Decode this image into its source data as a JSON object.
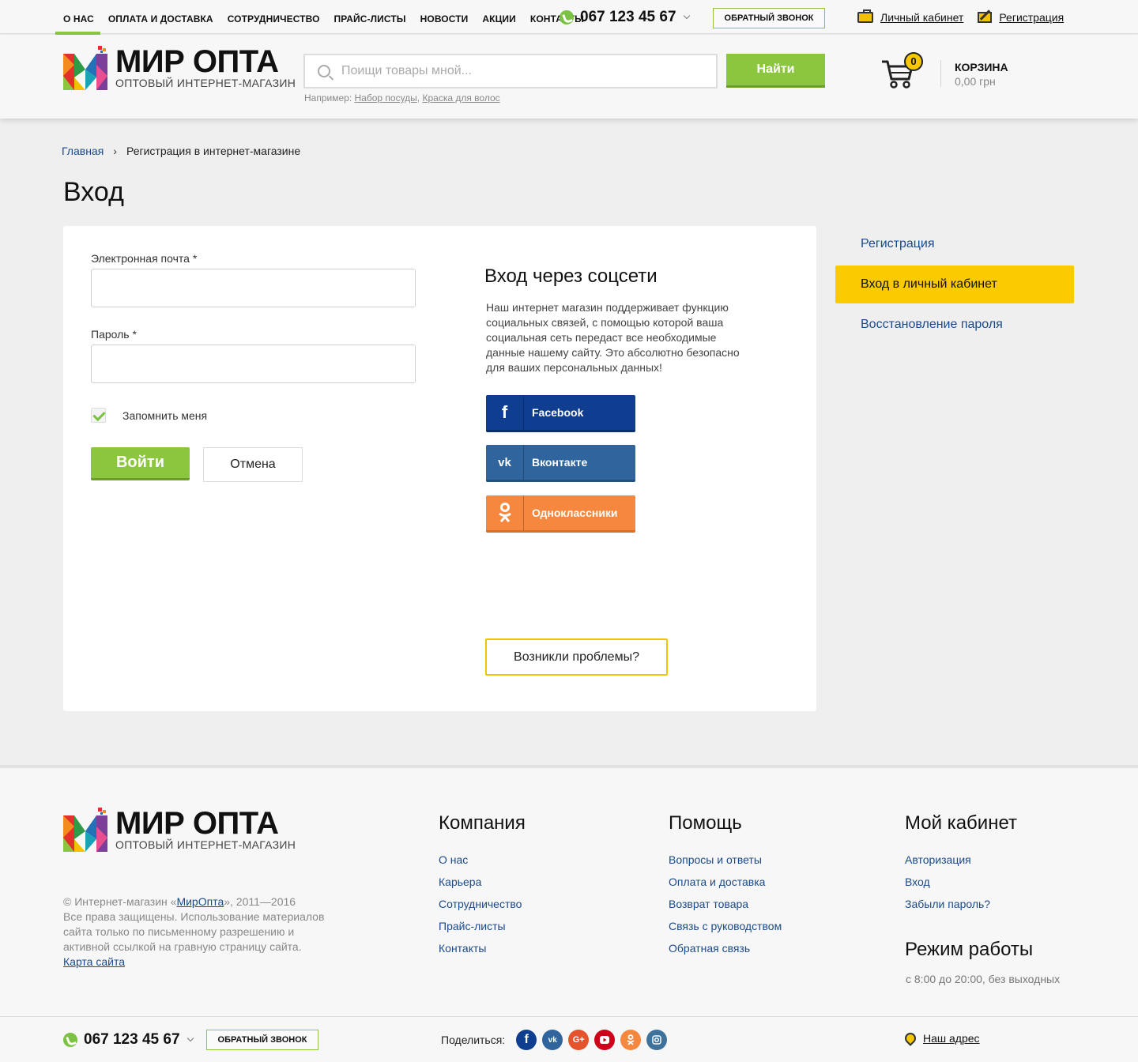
{
  "topnav": {
    "items": [
      "О нас",
      "Оплата и доставка",
      "Сотрудничество",
      "Прайс-листы",
      "Новости",
      "Акции",
      "Контакты"
    ],
    "phone": "067 123 45 67",
    "callback": "Обратный звонок",
    "account_link": "Личный кабинет",
    "register_link": "Регистрация"
  },
  "header": {
    "logo_title": "МИР ОПТА",
    "logo_subtitle": "ОПТОВЫЙ ИНТЕРНЕТ-МАГАЗИН",
    "search_placeholder": "Поищи товары мной...",
    "search_button": "Найти",
    "hint_prefix": "Например:",
    "hint_example_1": "Набор посуды",
    "hint_comma": ",",
    "hint_example_2": "Краска для волос",
    "cart_count": "0",
    "cart_label": "КОРЗИНА",
    "cart_total": "0,00 грн"
  },
  "breadcrumb": {
    "home": "Главная",
    "separator": "›",
    "current": "Регистрация в интернет-магазине"
  },
  "page_title": "Вход",
  "login_form": {
    "email_label": "Электронная почта *",
    "email_value": "",
    "password_label": "Пароль *",
    "password_value": "",
    "remember_label": "Запомнить меня",
    "remember_checked": true,
    "submit": "Войти",
    "cancel": "Отмена"
  },
  "social": {
    "title": "Вход через соцсети",
    "description": "Наш интернет магазин поддерживает функцию социальных связей, с помощью которой ваша социальная сеть передаст все необходимые данные нашему сайту. Это абсолютно безопасно для ваших персональных данных!",
    "facebook": "Facebook",
    "vk": "Вконтакте",
    "ok": "Одноклассники",
    "problems": "Возникли проблемы?"
  },
  "side_menu": {
    "items": [
      "Регистрация",
      "Вход в личный кабинет",
      "Восстановление пароля"
    ],
    "active_index": 1
  },
  "footer": {
    "copy_prefix": "© Интернет-магазин «",
    "copy_brand": "МирОпта",
    "copy_suffix": "», 2011—2016",
    "rights": "Все права защищены. Использование материалов сайта только по письменному разрешению и активной ссылкой на гравную страницу сайта.",
    "sitemap": "Карта сайта",
    "company": {
      "title": "Компания",
      "links": [
        "О нас",
        "Карьера",
        "Сотрудничество",
        "Прайс-листы",
        "Контакты"
      ]
    },
    "help": {
      "title": "Помощь",
      "links": [
        "Вопросы и ответы",
        "Оплата и доставка",
        "Возврат товара",
        "Связь с руководством",
        "Обратная связь"
      ]
    },
    "cabinet": {
      "title": "Мой кабинет",
      "links": [
        "Авторизация",
        "Вход",
        "Забыли пароль?"
      ]
    },
    "hours_title": "Режим работы",
    "hours": "с 8:00 до 20:00, без выходных",
    "phone": "067 123 45 67",
    "callback": "Обратный звонок",
    "share_label": "Поделиться:",
    "address": "Наш адрес"
  },
  "colors": {
    "accent_green": "#8cc63f",
    "accent_yellow": "#fcca00",
    "link_blue": "#1a4a8a",
    "facebook": "#0f3e91",
    "vk": "#2f659c",
    "ok": "#f5883e"
  },
  "icons": [
    "phone-icon",
    "chevron-down-icon",
    "briefcase-icon",
    "pen-icon",
    "search-icon",
    "cart-icon",
    "check-icon",
    "facebook-icon",
    "vk-icon",
    "ok-icon",
    "google-plus-icon",
    "youtube-icon",
    "instagram-icon",
    "map-pin-icon"
  ]
}
